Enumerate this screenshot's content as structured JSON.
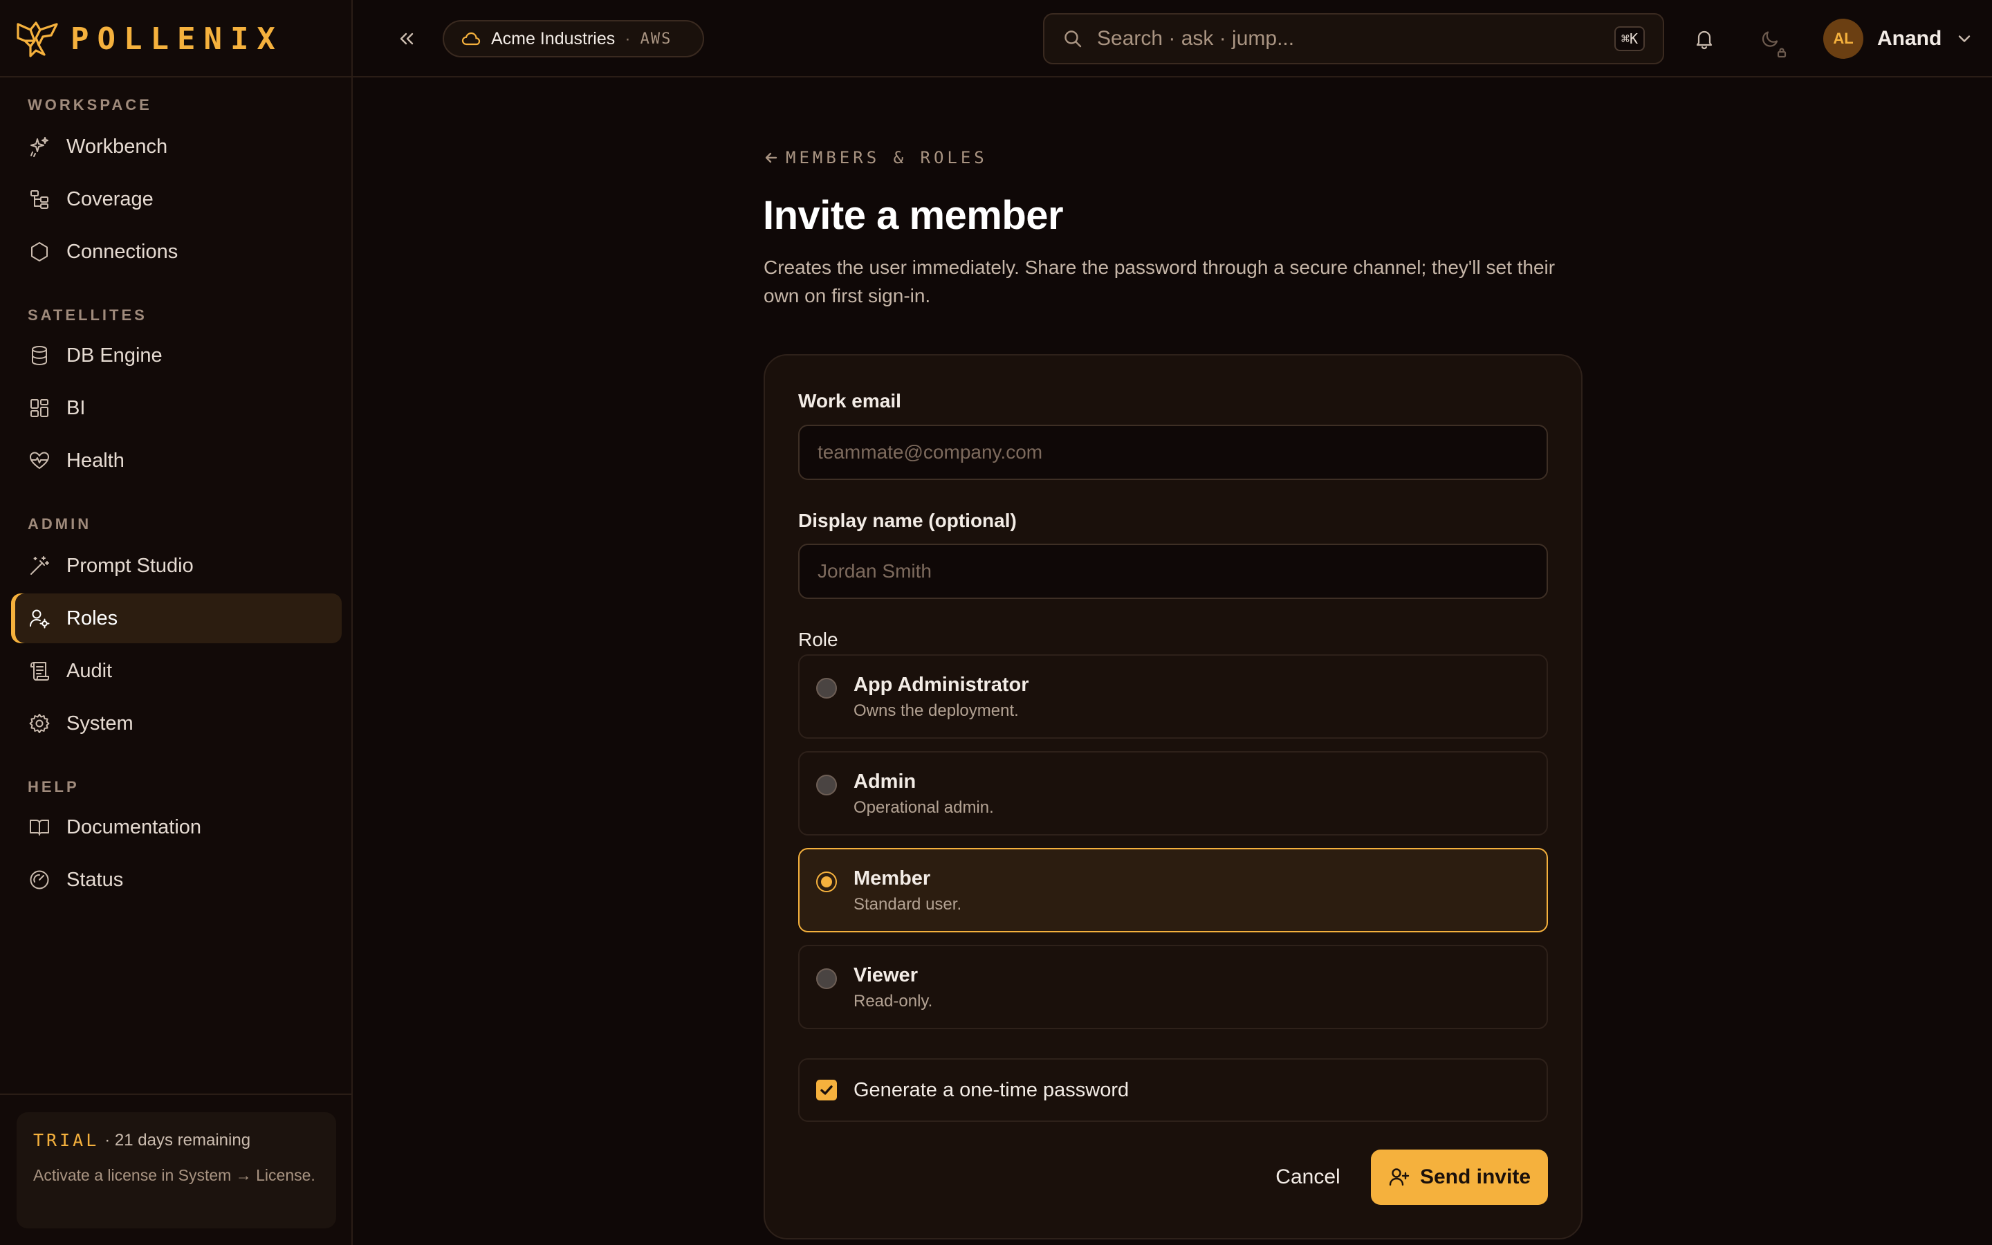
{
  "app": {
    "brand_name": "POLLENIX",
    "accent_color": "#f5b13d"
  },
  "sidebar": {
    "sections": [
      {
        "title": "WORKSPACE",
        "items": [
          {
            "label": "Workbench",
            "icon": "sparkles-icon"
          },
          {
            "label": "Coverage",
            "icon": "tree-structure-icon"
          },
          {
            "label": "Connections",
            "icon": "hexagon-icon"
          }
        ]
      },
      {
        "title": "SATELLITES",
        "items": [
          {
            "label": "DB Engine",
            "icon": "database-icon"
          },
          {
            "label": "BI",
            "icon": "dashboard-grid-icon"
          },
          {
            "label": "Health",
            "icon": "heart-pulse-icon"
          }
        ]
      },
      {
        "title": "ADMIN",
        "items": [
          {
            "label": "Prompt Studio",
            "icon": "magic-wand-icon"
          },
          {
            "label": "Roles",
            "icon": "user-cog-icon",
            "active": true
          },
          {
            "label": "Audit",
            "icon": "scroll-icon"
          },
          {
            "label": "System",
            "icon": "gear-icon"
          }
        ]
      },
      {
        "title": "HELP",
        "items": [
          {
            "label": "Documentation",
            "icon": "book-open-icon"
          },
          {
            "label": "Status",
            "icon": "gauge-icon"
          }
        ]
      }
    ],
    "trial": {
      "tag": "TRIAL",
      "remaining": "· 21 days remaining",
      "description": "Activate a license in System → License."
    }
  },
  "topbar": {
    "tenant": {
      "name": "Acme Industries",
      "separator": "·",
      "cloud": "AWS",
      "icon": "cloud-icon"
    },
    "search": {
      "placeholder": "Search · ask · jump...",
      "shortcut": "⌘K"
    },
    "user": {
      "initials": "AL",
      "name": "Anand"
    }
  },
  "page": {
    "back_label": "MEMBERS & ROLES",
    "title": "Invite a member",
    "description": "Creates the user immediately. Share the password through a secure channel; they'll set their own on first sign-in."
  },
  "form": {
    "email": {
      "label": "Work email",
      "placeholder": "teammate@company.com",
      "value": ""
    },
    "display_name": {
      "label": "Display name (optional)",
      "placeholder": "Jordan Smith",
      "value": ""
    },
    "role_label": "Role",
    "roles": [
      {
        "name": "App Administrator",
        "description": "Owns the deployment.",
        "selected": false
      },
      {
        "name": "Admin",
        "description": "Operational admin.",
        "selected": false
      },
      {
        "name": "Member",
        "description": "Standard user.",
        "selected": true
      },
      {
        "name": "Viewer",
        "description": "Read-only.",
        "selected": false
      }
    ],
    "generate_password": {
      "label": "Generate a one-time password",
      "checked": true
    },
    "cancel_label": "Cancel",
    "submit_label": "Send invite"
  }
}
